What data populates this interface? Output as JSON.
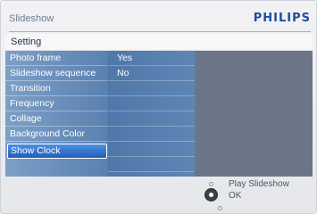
{
  "header": {
    "title": "Slideshow",
    "brand": "PHILIPS"
  },
  "section": {
    "title": "Setting"
  },
  "menu": {
    "items": [
      {
        "label": "Photo frame"
      },
      {
        "label": "Slideshow sequence"
      },
      {
        "label": "Transition"
      },
      {
        "label": "Frequency"
      },
      {
        "label": "Collage"
      },
      {
        "label": "Background Color"
      },
      {
        "label": "Show Clock",
        "selected": true
      }
    ],
    "options": [
      {
        "label": "Yes"
      },
      {
        "label": "No"
      }
    ]
  },
  "footer": {
    "play_hint": "Play Slideshow",
    "ok_hint": "OK"
  },
  "colors": {
    "brand": "#1e4ea1",
    "selected_item": "#2f74d0",
    "menu_column": "#6f93bf"
  }
}
